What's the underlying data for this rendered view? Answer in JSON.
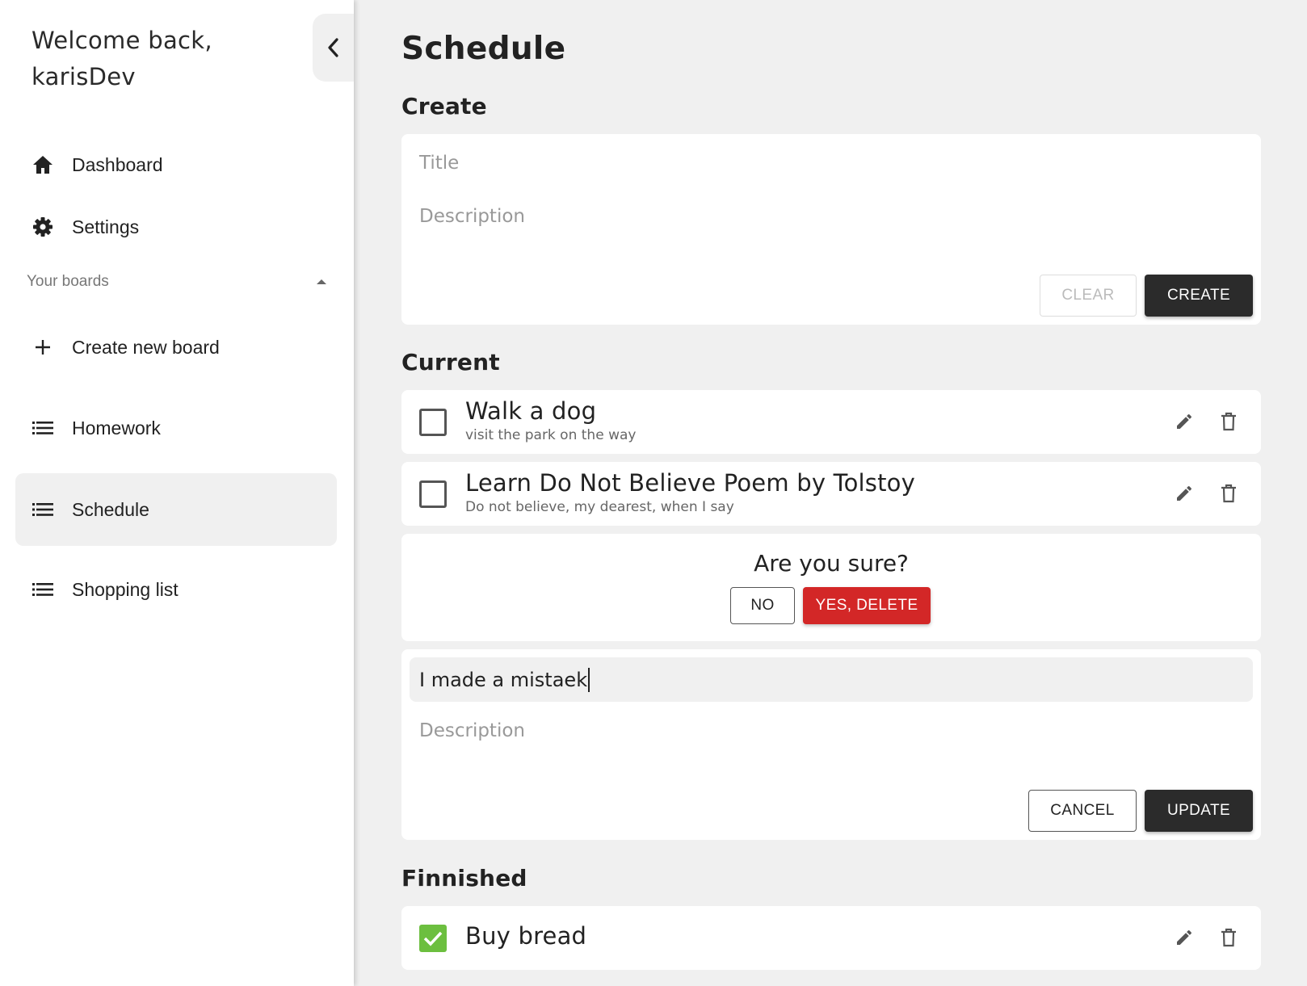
{
  "sidebar": {
    "welcome_line1": "Welcome back,",
    "welcome_line2": "karisDev",
    "nav": [
      {
        "label": "Dashboard",
        "icon": "home-icon"
      },
      {
        "label": "Settings",
        "icon": "gear-icon"
      }
    ],
    "boards_section_label": "Your boards",
    "create_board_label": "Create new board",
    "boards": [
      {
        "label": "Homework",
        "icon": "list-icon"
      },
      {
        "label": "Schedule",
        "icon": "list-icon",
        "active": true
      },
      {
        "label": "Shopping list",
        "icon": "list-icon"
      }
    ]
  },
  "main": {
    "page_title": "Schedule",
    "create_heading": "Create",
    "create_form": {
      "title_placeholder": "Title",
      "description_placeholder": "Description",
      "clear_label": "CLEAR",
      "create_label": "CREATE"
    },
    "current_heading": "Current",
    "current_tasks": [
      {
        "title": "Walk a dog",
        "description": "visit the park on the way",
        "done": false
      },
      {
        "title": "Learn Do Not Believe Poem by Tolstoy",
        "description": "Do not believe, my dearest, when I say",
        "done": false
      }
    ],
    "confirm_dialog": {
      "question": "Are you sure?",
      "no_label": "NO",
      "yes_label": "YES, DELETE"
    },
    "edit_form": {
      "title_value": "I made a mistaek",
      "description_placeholder": "Description",
      "cancel_label": "CANCEL",
      "update_label": "UPDATE"
    },
    "finished_heading": "Finnished",
    "finished_tasks": [
      {
        "title": "Buy bread",
        "done": true
      }
    ]
  },
  "colors": {
    "accent_dark": "#2b2b2b",
    "danger": "#d32727",
    "done_green": "#6cbf3f",
    "background": "#f0f0f0"
  }
}
